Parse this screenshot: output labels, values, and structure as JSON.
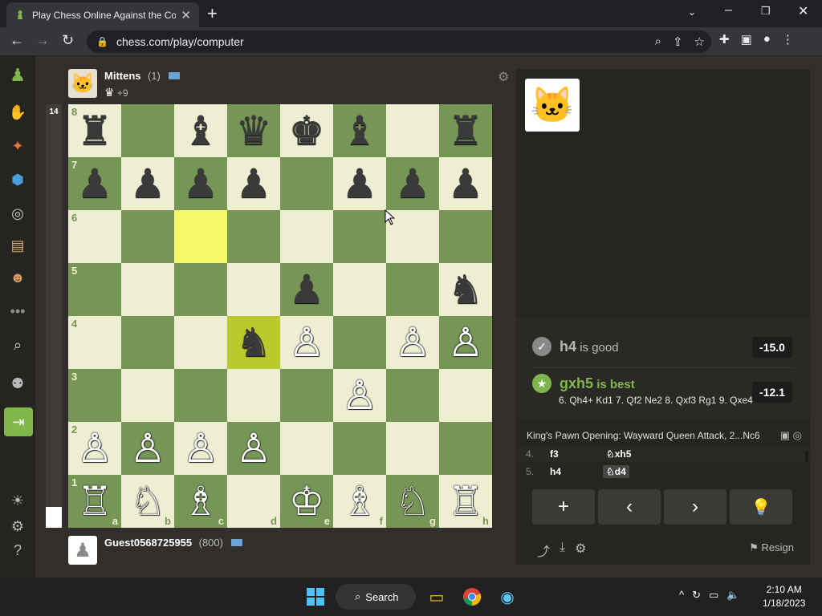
{
  "browser": {
    "tab_title": "Play Chess Online Against the Co",
    "url": "chess.com/play/computer"
  },
  "top_player": {
    "name": "Mittens",
    "rating": "(1)",
    "material": "+9"
  },
  "bottom_player": {
    "name": "Guest0568725955",
    "rating": "(800)"
  },
  "eval_bar": {
    "value": "14"
  },
  "board": {
    "ranks": [
      "8",
      "7",
      "6",
      "5",
      "4",
      "3",
      "2",
      "1"
    ],
    "files": [
      "a",
      "b",
      "c",
      "d",
      "e",
      "f",
      "g",
      "h"
    ],
    "squares": [
      [
        "♜",
        "",
        "♝",
        "♛",
        "♚",
        "♝",
        "",
        "♜"
      ],
      [
        "♟",
        "♟",
        "♟",
        "♟",
        "",
        "♟",
        "♟",
        "♟"
      ],
      [
        "",
        "",
        "",
        "",
        "",
        "",
        "",
        ""
      ],
      [
        "",
        "",
        "",
        "",
        "♟",
        "",
        "",
        "♞"
      ],
      [
        "",
        "",
        "",
        "♞",
        "♙",
        "",
        "♙",
        "♙"
      ],
      [
        "",
        "",
        "",
        "",
        "",
        "♙",
        "",
        ""
      ],
      [
        "♙",
        "♙",
        "♙",
        "♙",
        "",
        "",
        "",
        ""
      ],
      [
        "♖",
        "♘",
        "♗",
        "",
        "♔",
        "♗",
        "♘",
        "♖"
      ]
    ],
    "white_pieces_rows": [
      [
        0,
        0,
        0,
        0,
        0,
        0,
        0,
        0
      ],
      [
        0,
        0,
        0,
        0,
        0,
        0,
        0,
        0
      ],
      [
        0,
        0,
        0,
        0,
        0,
        0,
        0,
        0
      ],
      [
        0,
        0,
        0,
        0,
        0,
        0,
        0,
        0
      ],
      [
        0,
        0,
        0,
        0,
        1,
        0,
        1,
        1
      ],
      [
        0,
        0,
        0,
        0,
        0,
        1,
        0,
        0
      ],
      [
        1,
        1,
        1,
        1,
        0,
        0,
        0,
        0
      ],
      [
        1,
        1,
        1,
        0,
        1,
        1,
        1,
        1
      ]
    ],
    "highlighted": [
      "c6",
      "d4"
    ]
  },
  "coach": {
    "played_move": "h4",
    "played_label": "is good",
    "played_score": "-15.0",
    "best_move": "gxh5",
    "best_label": "is best",
    "best_score": "-12.1",
    "best_line": "6. Qh4+ Kd1 7. Qf2 Ne2 8. Qxf3 Rg1 9. Qxe4"
  },
  "opening": "King's Pawn Opening: Wayward Queen Attack, 2...Nc6",
  "moves": [
    {
      "no": "4.",
      "white": "f3",
      "black": "♘xh5"
    },
    {
      "no": "5.",
      "white": "h4",
      "black": "♘d4"
    }
  ],
  "controls": {
    "add": "+",
    "back": "‹",
    "forward": "›",
    "hint": "hint"
  },
  "resign_label": "Resign",
  "taskbar": {
    "search_label": "Search",
    "time": "2:10 AM",
    "date": "1/18/2023"
  }
}
